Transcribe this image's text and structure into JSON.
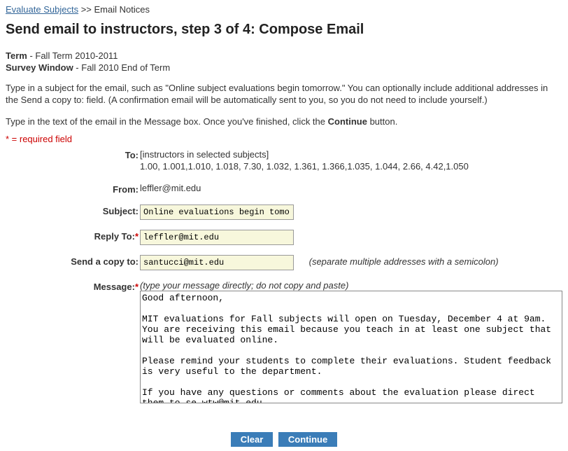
{
  "breadcrumb": {
    "link": "Evaluate Subjects",
    "sep": ">>",
    "current": "Email Notices"
  },
  "heading": "Send email to instructors, step 3 of 4: Compose Email",
  "term_label": "Term",
  "term_value": "Fall Term 2010-2011",
  "window_label": "Survey Window",
  "window_value": "Fall 2010 End of Term",
  "instructions1": "Type in a subject for the email, such as \"Online subject evaluations begin tomorrow.\" You can optionally include additional addresses in the Send a copy to: field. (A confirmation email will be automatically sent to you, so you do not need to include yourself.)",
  "instructions2_a": "Type in the text of the email in the Message box. Once you've finished, click the ",
  "instructions2_b": "Continue",
  "instructions2_c": " button.",
  "required_note": "* = required field",
  "labels": {
    "to": "To:",
    "from": "From:",
    "subject": "Subject:",
    "reply_to": "Reply To:",
    "copy_to": "Send a copy to:",
    "message": "Message:"
  },
  "to_line1": "[instructors in selected subjects]",
  "to_line2": "1.00, 1.001,1.010, 1.018, 7.30, 1.032, 1.361, 1.366,1.035, 1.044, 2.66, 4.42,1.050",
  "from_value": "leffler@mit.edu",
  "subject_value": "Online evaluations begin tomorrow",
  "reply_to_value": "leffler@mit.edu",
  "copy_to_value": "santucci@mit.edu",
  "copy_hint": "(separate multiple addresses with a semicolon)",
  "message_hint": "(type your message directly; do not copy and paste)",
  "message_body": "Good afternoon,\n\nMIT evaluations for Fall subjects will open on Tuesday, December 4 at 9am. You are receiving this email because you teach in at least one subject that will be evaluated online.\n\nPlease remind your students to complete their evaluations. Student feedback is very useful to the department.\n\nIf you have any questions or comments about the evaluation please direct them to se-wtw@mit.edu.",
  "buttons": {
    "clear": "Clear",
    "continue": "Continue"
  }
}
